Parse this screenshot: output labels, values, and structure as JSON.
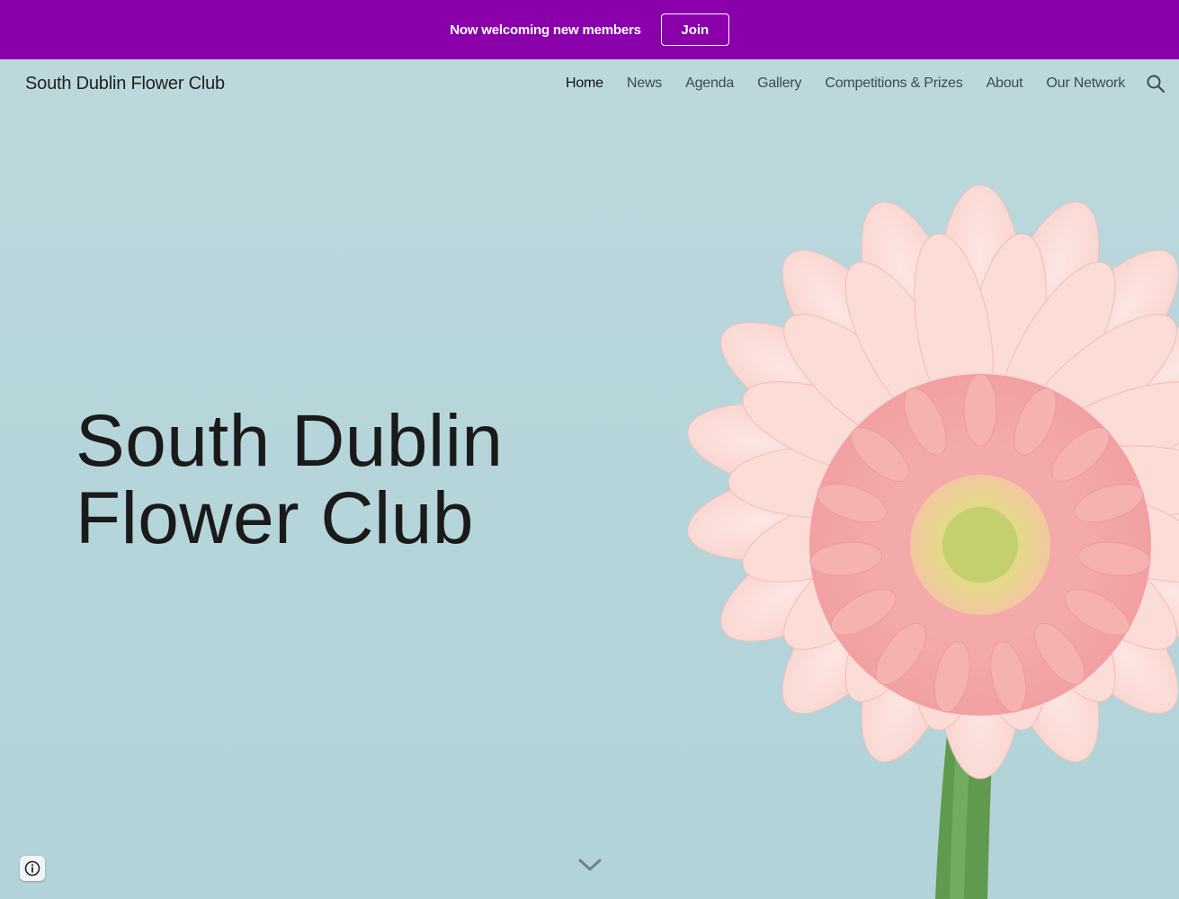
{
  "banner": {
    "text": "Now welcoming new members",
    "join_label": "Join",
    "background_color": "#8a00aa"
  },
  "header": {
    "site_title": "South Dublin Flower Club",
    "nav": [
      {
        "label": "Home",
        "active": true
      },
      {
        "label": "News",
        "active": false
      },
      {
        "label": "Agenda",
        "active": false
      },
      {
        "label": "Gallery",
        "active": false
      },
      {
        "label": "Competitions & Prizes",
        "active": false
      },
      {
        "label": "About",
        "active": false
      },
      {
        "label": "Our Network",
        "active": false
      }
    ],
    "search_icon": "search-icon"
  },
  "hero": {
    "title_line1": "South Dublin",
    "title_line2": "Flower Club",
    "scroll_icon": "chevron-down-icon",
    "background_color": "#b7d6db"
  },
  "footer": {
    "info_icon": "info-icon"
  }
}
